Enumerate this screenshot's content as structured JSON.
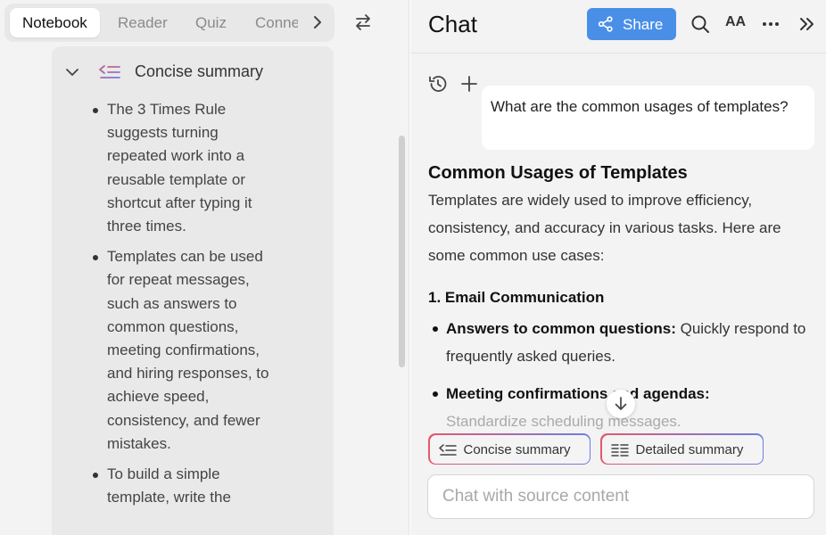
{
  "notebook_tabs": [
    {
      "label": "Notebook",
      "active": true
    },
    {
      "label": "Reader",
      "active": false
    },
    {
      "label": "Quiz",
      "active": false
    },
    {
      "label": "Conne",
      "active": false
    }
  ],
  "summary_card": {
    "title": "Concise summary",
    "bullets": [
      "The 3 Times Rule suggests turning repeated work into a reusable template or shortcut after typing it three times.",
      "Templates can be used for repeat messages, such as answers to common questions, meeting confirmations, and hiring responses, to achieve speed, consistency, and fewer mistakes.",
      "To build a simple template, write the"
    ]
  },
  "chat": {
    "title": "Chat",
    "share_label": "Share",
    "font_size_label": "AA",
    "user_message": "What are the common usages of templates?",
    "answer": {
      "heading": "Common Usages of Templates",
      "intro": "Templates are widely used to improve efficiency, consistency, and accuracy in various tasks. Here are some common use cases:",
      "section_title": "1. Email Communication",
      "items": [
        {
          "bold": "Answers to common questions:",
          "text": " Quickly respond to frequently asked queries."
        },
        {
          "bold": "Meeting confirmations and agendas:",
          "text": ""
        }
      ],
      "faded_text": "Standardize scheduling messages."
    },
    "chips": [
      "Concise summary",
      "Detailed summary"
    ],
    "input_placeholder": "Chat with source content"
  },
  "colors": {
    "accent": "#4a8fe7",
    "chip_gradient_start": "#e35a6d",
    "chip_gradient_end": "#6d7ee6"
  }
}
